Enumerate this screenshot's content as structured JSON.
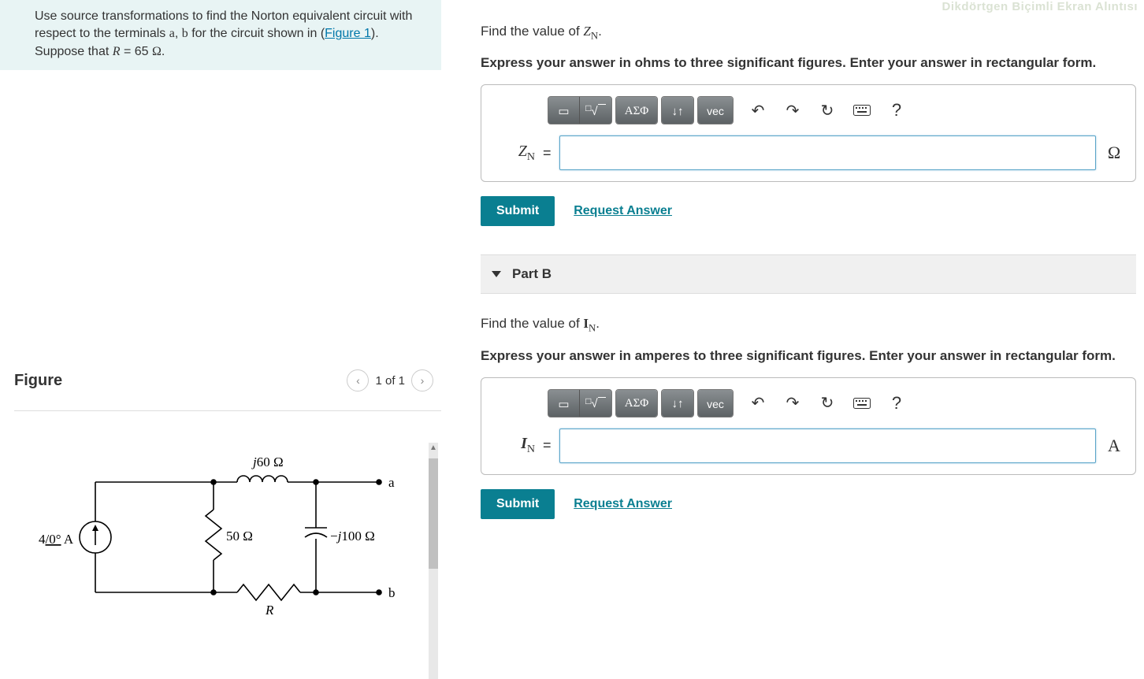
{
  "top_faded_text": "Dikdörtgen Biçimli Ekran Alıntısı",
  "problem": {
    "text_pre": "Use source transformations to find the Norton equivalent circuit with respect to the terminals ",
    "term_a": "a",
    "sep1": ", ",
    "term_b": "b",
    "text_mid": " for the circuit shown in (",
    "figure_link": "Figure 1",
    "text_post1": "). Suppose that ",
    "R_var": "R",
    "eq": " = 65 ",
    "ohm": "Ω",
    "dot": "."
  },
  "figure": {
    "title": "Figure",
    "counter": "1 of 1",
    "labels": {
      "j60": "j60 Ω",
      "fifty": "50 Ω",
      "neg_j100": "−j100 Ω",
      "source": "4",
      "source_angle": "/0°",
      "source_unit": " A",
      "R": "R",
      "a": "a",
      "b": "b"
    }
  },
  "partA": {
    "find_pre": "Find the value of ",
    "var": "Z",
    "sub": "N",
    "find_post": ".",
    "instr": "Express your answer in ohms to three significant figures. Enter your answer in rectangular form.",
    "var_label_html": "Z",
    "var_sub": "N",
    "unit": "Ω",
    "submit": "Submit",
    "request": "Request Answer"
  },
  "partB": {
    "header": "Part B",
    "find_pre": "Find the value of ",
    "var": "I",
    "sub": "N",
    "find_post": ".",
    "instr": "Express your answer in amperes to three significant figures. Enter your answer in rectangular form.",
    "var_label_html": "I",
    "var_sub": "N",
    "unit": "A",
    "submit": "Submit",
    "request": "Request Answer"
  },
  "toolbar": {
    "sqrt": "√",
    "asig": "ΑΣΦ",
    "arrows": "↓↑",
    "vec": "vec",
    "undo": "↶",
    "redo": "↷",
    "reset": "↻",
    "keyboard": "⌨",
    "help": "?"
  }
}
